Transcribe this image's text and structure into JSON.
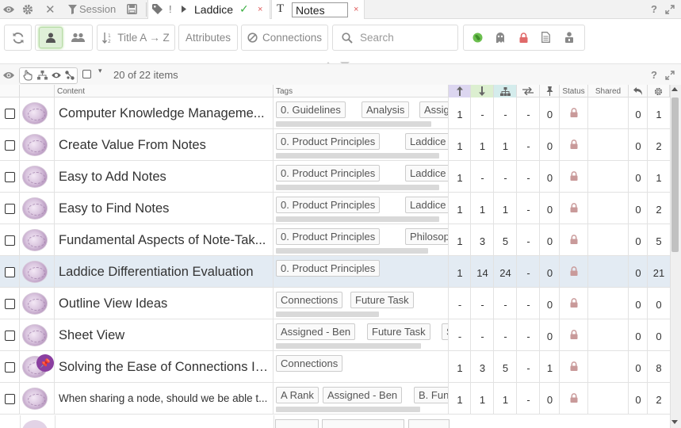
{
  "topbar": {
    "session_label": "Session",
    "tab_bang": "!",
    "laddice_label": "Laddice",
    "check_glyph": "✓",
    "close_glyph": "×",
    "notes_value": "Notes",
    "help_glyph": "?"
  },
  "toolbar": {
    "sort_label": "Title A → Z",
    "attributes_label": "Attributes",
    "connections_label": "Connections",
    "search_placeholder": "Search"
  },
  "list_header": {
    "count_label": "20 of 22 items",
    "help_glyph": "?"
  },
  "columns": {
    "content": "Content",
    "tags": "Tags",
    "status": "Status",
    "shared": "Shared"
  },
  "rows": [
    {
      "title": "Computer Knowledge Manageme...",
      "small": false,
      "selected": false,
      "pinned": false,
      "tags": [
        "0. Guidelines",
        "Analysis",
        "Assigned"
      ],
      "c_up": "1",
      "c_down": "-",
      "c_tree": "-",
      "c_swap": "-",
      "c_pin": "0",
      "c_reply": "0",
      "c_gear": "1"
    },
    {
      "title": "Create Value From Notes",
      "small": false,
      "selected": false,
      "pinned": false,
      "tags": [
        "0. Product Principles",
        "Laddice Insi"
      ],
      "c_up": "1",
      "c_down": "1",
      "c_tree": "1",
      "c_swap": "-",
      "c_pin": "0",
      "c_reply": "0",
      "c_gear": "2"
    },
    {
      "title": "Easy to Add Notes",
      "small": false,
      "selected": false,
      "pinned": false,
      "tags": [
        "0. Product Principles",
        "Laddice Insi"
      ],
      "c_up": "1",
      "c_down": "-",
      "c_tree": "-",
      "c_swap": "-",
      "c_pin": "0",
      "c_reply": "0",
      "c_gear": "1"
    },
    {
      "title": "Easy to Find Notes",
      "small": false,
      "selected": false,
      "pinned": false,
      "tags": [
        "0. Product Principles",
        "Laddice Insi"
      ],
      "c_up": "1",
      "c_down": "1",
      "c_tree": "1",
      "c_swap": "-",
      "c_pin": "0",
      "c_reply": "0",
      "c_gear": "2"
    },
    {
      "title": "Fundamental Aspects of Note-Tak...",
      "small": false,
      "selected": false,
      "pinned": false,
      "tags": [
        "0. Product Principles",
        "Philosophy"
      ],
      "c_up": "1",
      "c_down": "3",
      "c_tree": "5",
      "c_swap": "-",
      "c_pin": "0",
      "c_reply": "0",
      "c_gear": "5"
    },
    {
      "title": "Laddice Differentiation Evaluation",
      "small": false,
      "selected": true,
      "pinned": false,
      "tags": [
        "0. Product Principles"
      ],
      "c_up": "1",
      "c_down": "14",
      "c_tree": "24",
      "c_swap": "-",
      "c_pin": "0",
      "c_reply": "0",
      "c_gear": "21"
    },
    {
      "title": "Outline View Ideas",
      "small": false,
      "selected": false,
      "pinned": false,
      "tags": [
        "Connections",
        "Future Task"
      ],
      "c_up": "-",
      "c_down": "-",
      "c_tree": "-",
      "c_swap": "-",
      "c_pin": "0",
      "c_reply": "0",
      "c_gear": "0"
    },
    {
      "title": "Sheet View",
      "small": false,
      "selected": false,
      "pinned": false,
      "tags": [
        "Assigned - Ben",
        "Future Task",
        "Sh"
      ],
      "c_up": "-",
      "c_down": "-",
      "c_tree": "-",
      "c_swap": "-",
      "c_pin": "0",
      "c_reply": "0",
      "c_gear": "0"
    },
    {
      "title": "Solving the Ease of Connections Is...",
      "small": false,
      "selected": false,
      "pinned": true,
      "tags": [
        "Connections"
      ],
      "c_up": "1",
      "c_down": "3",
      "c_tree": "5",
      "c_swap": "-",
      "c_pin": "1",
      "c_reply": "0",
      "c_gear": "8"
    },
    {
      "title": "When sharing a node, should we be able t...",
      "small": true,
      "selected": false,
      "pinned": false,
      "tags": [
        "A Rank",
        "Assigned - Ben",
        "B. Func"
      ],
      "c_up": "1",
      "c_down": "1",
      "c_tree": "1",
      "c_swap": "-",
      "c_pin": "0",
      "c_reply": "0",
      "c_gear": "2"
    }
  ],
  "colors": {
    "up_header": "#dcd6f0",
    "down_header": "#dcefd0",
    "tree_header": "#d4ecec",
    "lock": "#c99a9a",
    "selected_row": "#e3ebf3",
    "active_button": "#dff0d8"
  }
}
